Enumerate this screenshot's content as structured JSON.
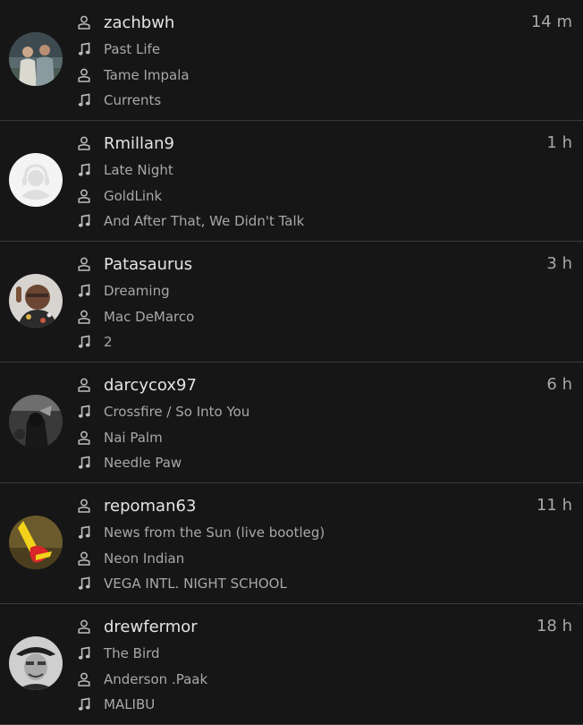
{
  "colors": {
    "background": "#161616",
    "divider": "#3a3a3a",
    "primary_text": "#e4e4e4",
    "secondary_text": "#a8a8a8",
    "icon": "#bdbdbd"
  },
  "icons": {
    "user": "person-icon",
    "track": "music-note-icon",
    "artist": "person-icon",
    "album": "music-note-icon"
  },
  "scrobbles": [
    {
      "username": "zachbwh",
      "time": "14 m",
      "track": "Past Life",
      "artist": "Tame Impala",
      "album": "Currents",
      "avatar": "two-people-photo"
    },
    {
      "username": "Rmillan9",
      "time": "1 h",
      "track": "Late Night",
      "artist": "GoldLink",
      "album": "And After That, We Didn't Talk",
      "avatar": "default-placeholder"
    },
    {
      "username": "Patasaurus",
      "time": "3 h",
      "track": "Dreaming",
      "artist": "Mac DeMarco",
      "album": "2",
      "avatar": "boy-photo"
    },
    {
      "username": "darcycox97",
      "time": "6 h",
      "track": "Crossfire / So Into You",
      "artist": "Nai Palm",
      "album": "Needle Paw",
      "avatar": "dark-photo"
    },
    {
      "username": "repoman63",
      "time": "11 h",
      "track": "News from the Sun (live bootleg)",
      "artist": "Neon Indian",
      "album": "VEGA INTL. NIGHT SCHOOL",
      "avatar": "yellow-object-photo"
    },
    {
      "username": "drewfermor",
      "time": "18 h",
      "track": "The Bird",
      "artist": "Anderson .Paak",
      "album": "MALIBU",
      "avatar": "man-with-hat-photo"
    }
  ]
}
